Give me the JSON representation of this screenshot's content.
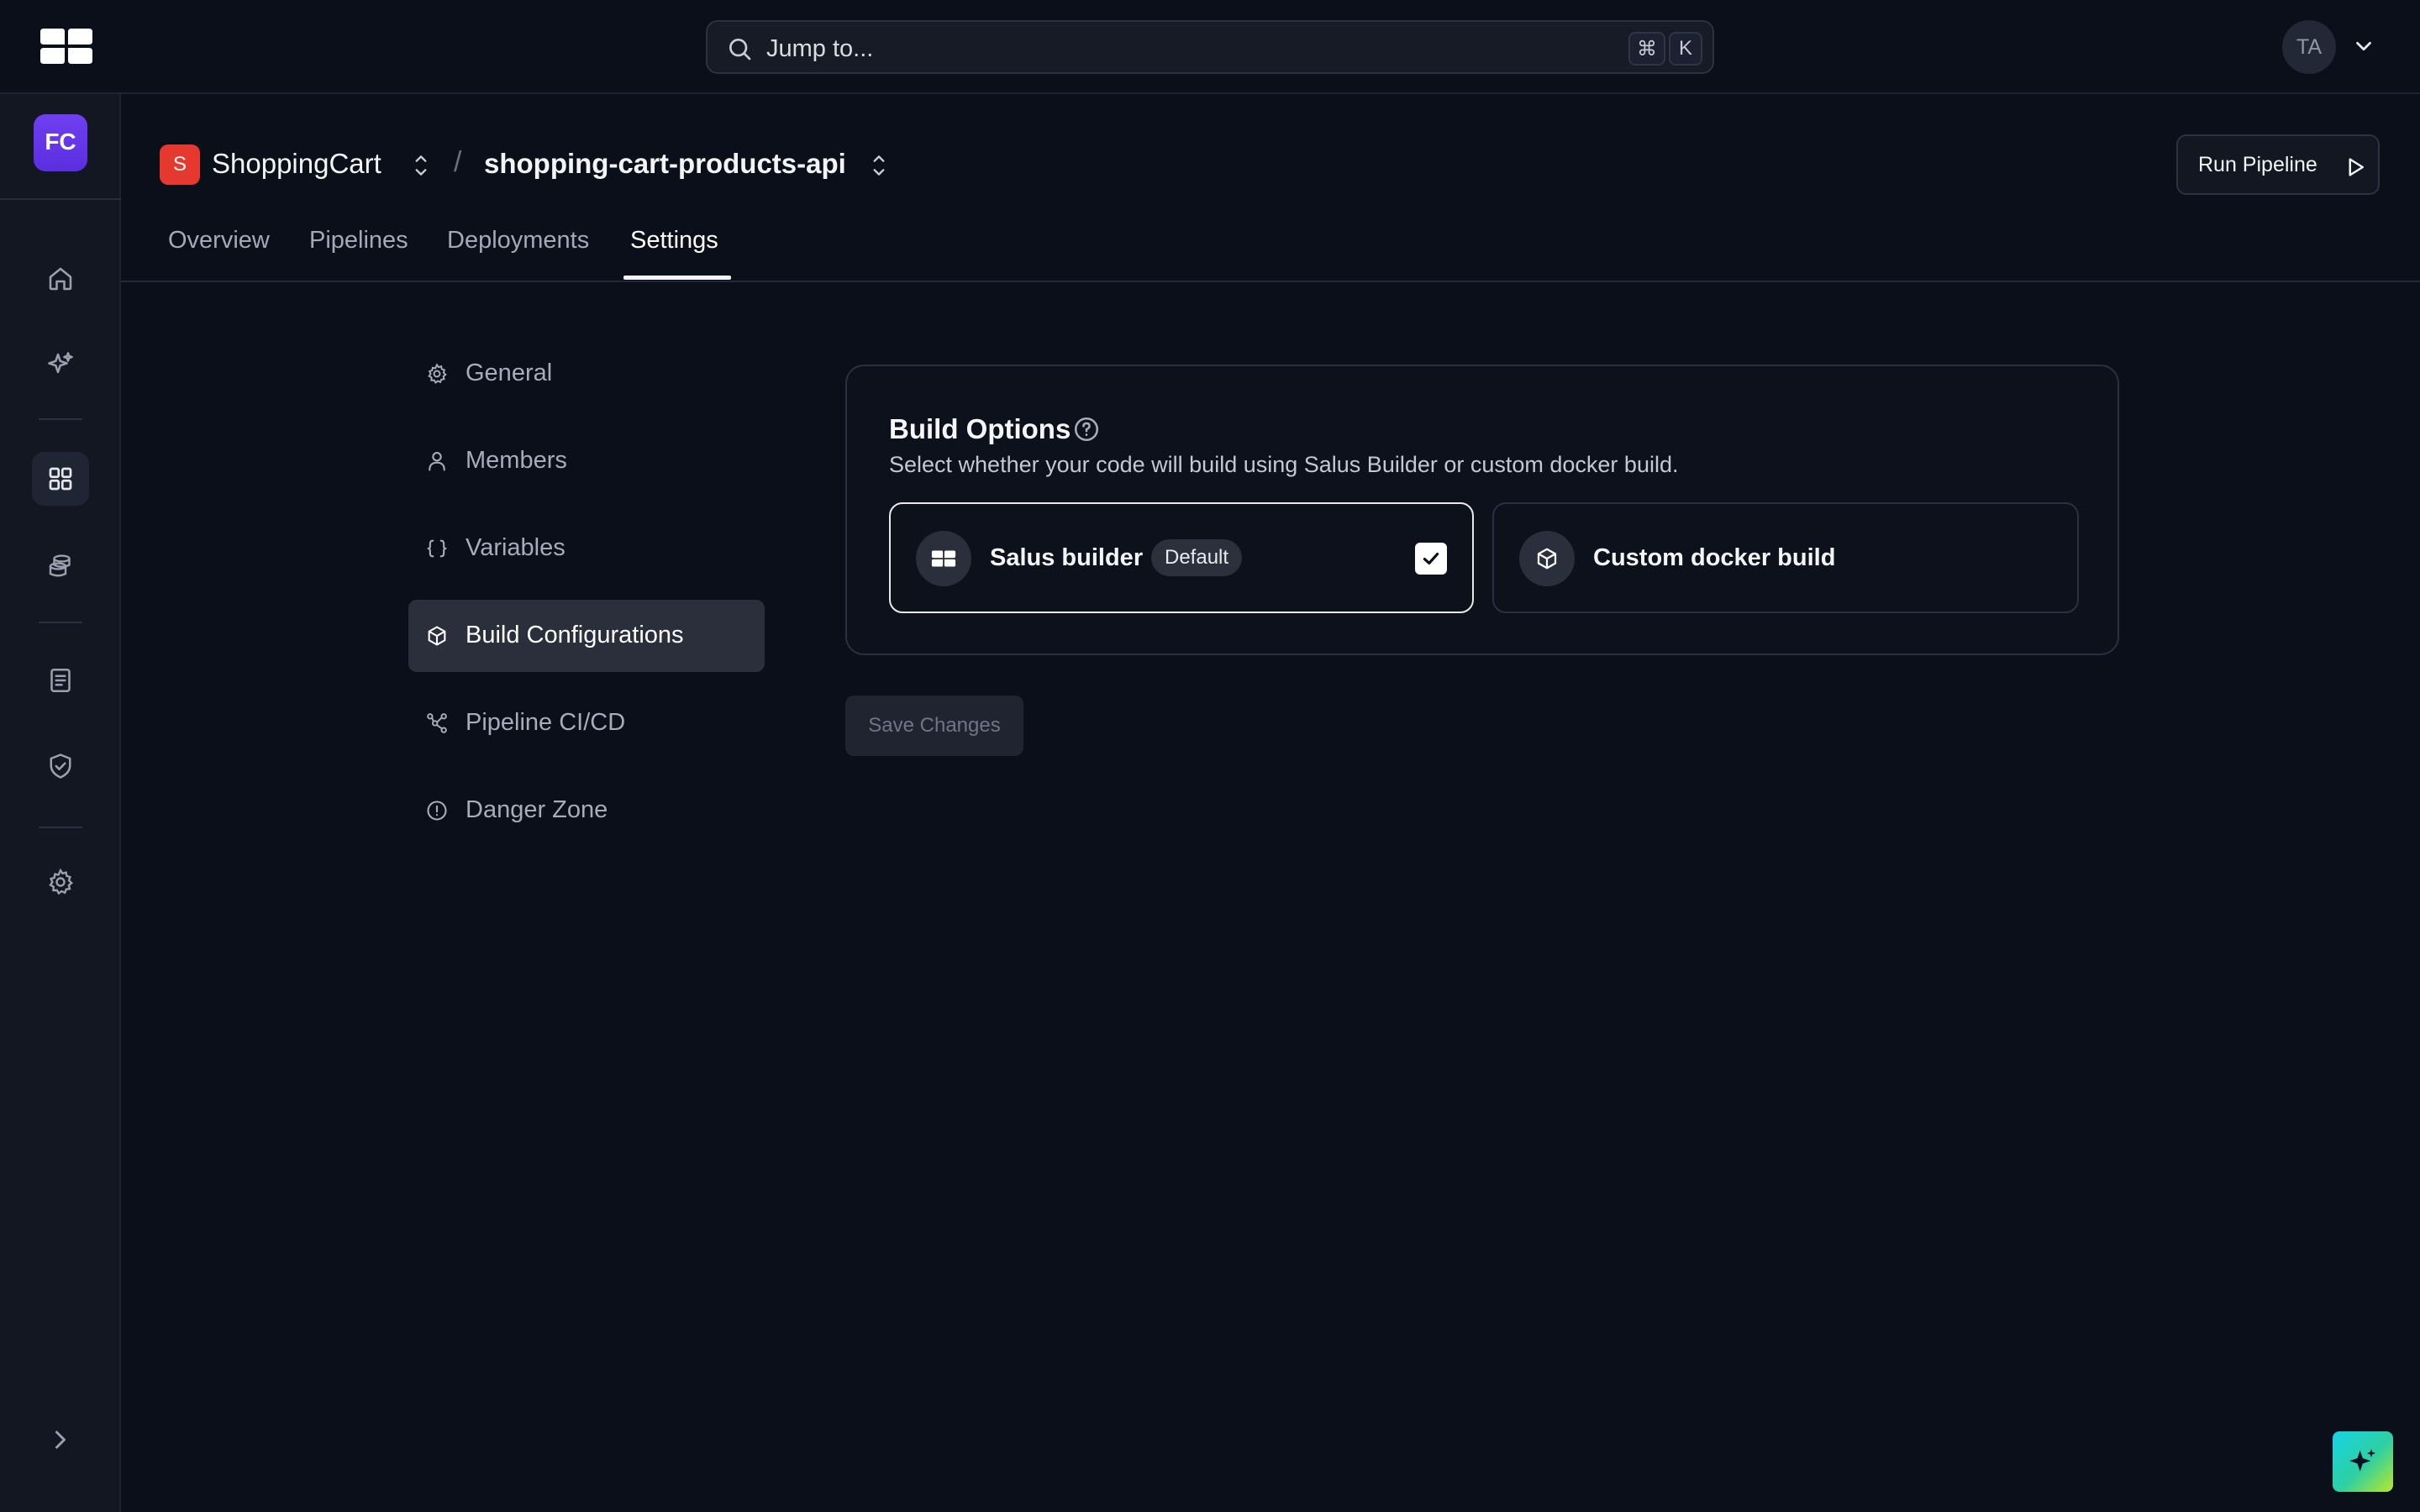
{
  "search": {
    "placeholder": "Jump to...",
    "shortcut_cmd": "⌘",
    "shortcut_key": "K"
  },
  "user": {
    "initials": "TA"
  },
  "org": {
    "initials": "FC"
  },
  "breadcrumb": {
    "project_initial": "S",
    "project": "ShoppingCart",
    "separator": "/",
    "repo": "shopping-cart-products-api"
  },
  "header": {
    "run_pipeline_label": "Run Pipeline"
  },
  "tabs": [
    {
      "label": "Overview"
    },
    {
      "label": "Pipelines"
    },
    {
      "label": "Deployments"
    },
    {
      "label": "Settings",
      "active": true
    }
  ],
  "settings_nav": [
    {
      "label": "General",
      "icon": "gear-icon"
    },
    {
      "label": "Members",
      "icon": "user-icon"
    },
    {
      "label": "Variables",
      "icon": "braces-icon"
    },
    {
      "label": "Build Configurations",
      "icon": "cube-icon",
      "active": true
    },
    {
      "label": "Pipeline CI/CD",
      "icon": "pipeline-icon"
    },
    {
      "label": "Danger Zone",
      "icon": "alert-icon"
    }
  ],
  "build_options": {
    "title": "Build Options",
    "description": "Select whether your code will build using Salus Builder or custom docker build.",
    "options": [
      {
        "label": "Salus builder",
        "badge": "Default",
        "selected": true,
        "icon": "salus-logo-icon"
      },
      {
        "label": "Custom docker build",
        "selected": false,
        "icon": "cube-icon"
      }
    ]
  },
  "actions": {
    "save_label": "Save Changes"
  },
  "colors": {
    "background": "#0b0f19",
    "project_badge": "#e5392f",
    "org_avatar": "#6336e8"
  }
}
